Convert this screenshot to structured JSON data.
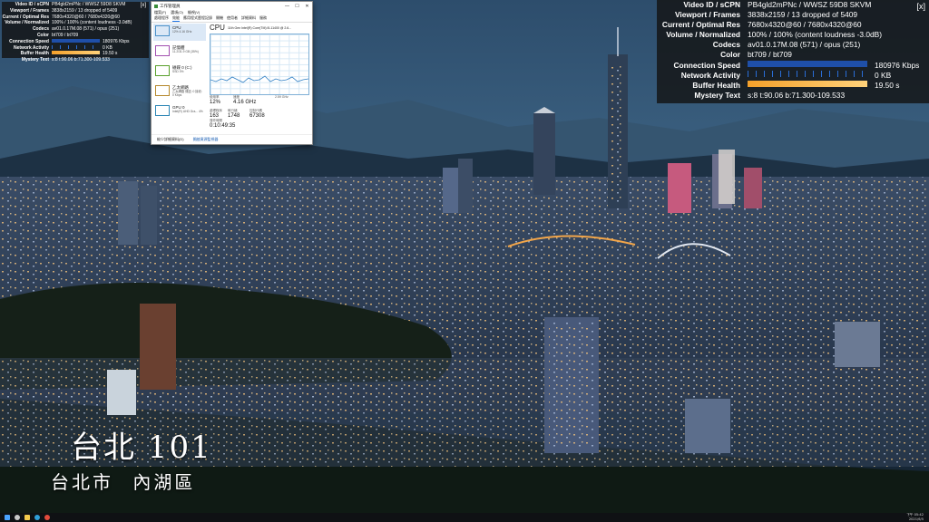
{
  "stats": {
    "close_label": "[x]",
    "small": {
      "rows": [
        {
          "label": "Video ID / sCPN",
          "value": "PB4gld2mPNc / WWSZ 59D8 SKVM"
        },
        {
          "label": "Viewport / Frames",
          "value": "3838x2159 / 13 dropped of 5409"
        },
        {
          "label": "Current / Optimal Res",
          "value": "7680x4320@60 / 7680x4320@60"
        },
        {
          "label": "Volume / Normalized",
          "value": "100% / 100% (content loudness -3.0dB)"
        },
        {
          "label": "Codecs",
          "value": "av01.0.17M.08 (571) / opus (251)"
        },
        {
          "label": "Color",
          "value": "bt709 / bt709"
        },
        {
          "label": "Connection Speed",
          "value": "180976 Kbps"
        },
        {
          "label": "Network Activity",
          "value": "0 KB"
        },
        {
          "label": "Buffer Health",
          "value": "19.50 s"
        },
        {
          "label": "Mystery Text",
          "value": "s:8 t:90.06 b:71.300-109.533"
        }
      ]
    },
    "big": {
      "rows": [
        {
          "label": "Video ID / sCPN",
          "value": "PB4gld2mPNc / WWSZ 59D8 SKVM"
        },
        {
          "label": "Viewport / Frames",
          "value": "3838x2159 / 13 dropped of 5409"
        },
        {
          "label": "Current / Optimal Res",
          "value": "7680x4320@60 / 7680x4320@60"
        },
        {
          "label": "Volume / Normalized",
          "value": "100% / 100% (content loudness -3.0dB)"
        },
        {
          "label": "Codecs",
          "value": "av01.0.17M.08 (571) / opus (251)"
        },
        {
          "label": "Color",
          "value": "bt709 / bt709"
        },
        {
          "label": "Connection Speed",
          "value": "180976 Kbps"
        },
        {
          "label": "Network Activity",
          "value": "0 KB"
        },
        {
          "label": "Buffer Health",
          "value": "19.50 s"
        },
        {
          "label": "Mystery Text",
          "value": "s:8 t:90.06 b:71.300-109.533"
        }
      ]
    },
    "colors": {
      "connection": "#1f4fa8",
      "buffer": "#f3a02b",
      "activity": "#2a6dd6"
    }
  },
  "caption": {
    "title": "台北 101",
    "sub_left": "台北市",
    "sub_right": "內湖區"
  },
  "taskmgr": {
    "title": "工作管理員",
    "controls": [
      "—",
      "☐",
      "✕"
    ],
    "menu": [
      "檔案(F)",
      "選項(O)",
      "檢視(V)"
    ],
    "tabs": [
      "處理程序",
      "效能",
      "應用程式歷程記錄",
      "開機",
      "使用者",
      "詳細資料",
      "服務"
    ],
    "side": [
      {
        "name": "CPU",
        "detail": "12% 4.16 GHz",
        "color": "#4a90c8"
      },
      {
        "name": "記憶體",
        "detail": "11.2/31.9 GB (35%)",
        "color": "#a24fb0"
      },
      {
        "name": "磁碟 0 (C:)",
        "detail": "SSD 0%",
        "color": "#5aa02c"
      },
      {
        "name": "乙太網路",
        "detail": "乙太網路 傳送: 0 接收: 0 Kbps",
        "color": "#b5882c"
      },
      {
        "name": "GPU 0",
        "detail": "Intel(R) UHD Gra... 4%",
        "color": "#2c86b5"
      }
    ],
    "cpu_title": "CPU",
    "cpu_model": "11th Gen Intel(R) Core(TM) i5-11400 @ 2.6...",
    "usage_label": "使用率",
    "usage": "12%",
    "speed_label": "速度",
    "speed": "4.16 GHz",
    "proc_label": "處理程序",
    "proc": "163",
    "threads_label": "執行緒",
    "threads": "1748",
    "handles_label": "控制代碼",
    "handles": "67308",
    "uptime_label": "運作時間",
    "uptime": "0:10:49:35",
    "base_speed": "2.59 GHz",
    "footer_less": "較少詳細資料(D)",
    "footer_monitor": "開啟資源監視器",
    "graph_color": "#2f7fc4"
  },
  "taskbar": {
    "time": "下午 05:42",
    "date": "2021/6/5",
    "icons": [
      "start-icon",
      "search-icon",
      "explorer-icon",
      "edge-icon",
      "chrome-icon"
    ]
  }
}
